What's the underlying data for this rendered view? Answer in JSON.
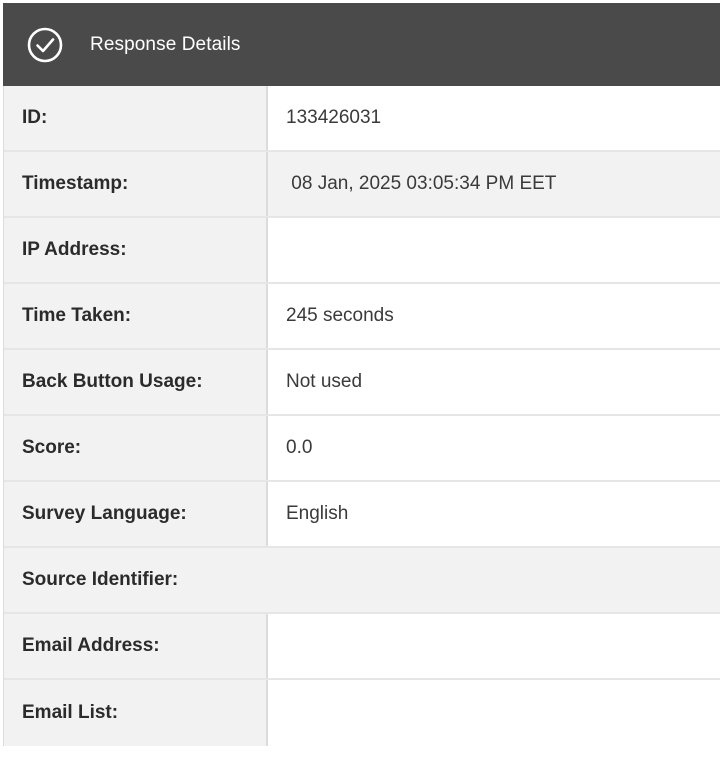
{
  "header": {
    "title": "Response Details",
    "icon": "check-circle-icon"
  },
  "rows": [
    {
      "label": "ID:",
      "value": "133426031"
    },
    {
      "label": "Timestamp:",
      "value": " 08 Jan, 2025 03:05:34 PM EET"
    },
    {
      "label": "IP Address:",
      "value": ""
    },
    {
      "label": "Time Taken:",
      "value": "245 seconds"
    },
    {
      "label": "Back Button Usage:",
      "value": "Not used"
    },
    {
      "label": "Score:",
      "value": "0.0"
    },
    {
      "label": "Survey Language:",
      "value": "English"
    },
    {
      "label": "Source Identifier:",
      "value": ""
    },
    {
      "label": "Email Address:",
      "value": ""
    },
    {
      "label": "Email List:",
      "value": ""
    }
  ],
  "colors": {
    "header_bg": "#4a4a4a",
    "label_bg": "#f2f2f2",
    "value_bg": "#ffffff"
  }
}
